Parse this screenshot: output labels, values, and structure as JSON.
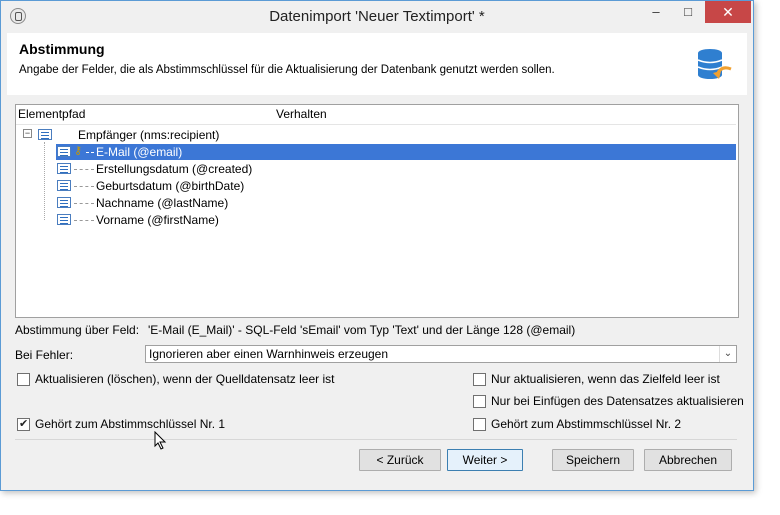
{
  "window": {
    "title": "Datenimport 'Neuer Textimport' *",
    "minimize": "–",
    "maximize": "□",
    "close": "✕"
  },
  "header": {
    "title": "Abstimmung",
    "subtitle": "Angabe der Felder, die als Abstimmschlüssel für die Aktualisierung der Datenbank genutzt werden sollen.",
    "icon": "database-sync-icon"
  },
  "tree": {
    "columns": [
      "Elementpfad",
      "Verhalten"
    ],
    "root": "Empfänger (nms:recipient)",
    "children": [
      {
        "label": "E-Mail (@email)",
        "selected": true,
        "key": true
      },
      {
        "label": "Erstellungsdatum (@created)",
        "selected": false,
        "key": false
      },
      {
        "label": "Geburtsdatum (@birthDate)",
        "selected": false,
        "key": false
      },
      {
        "label": "Nachname (@lastName)",
        "selected": false,
        "key": false
      },
      {
        "label": "Vorname (@firstName)",
        "selected": false,
        "key": false
      }
    ]
  },
  "reconciliation": {
    "label": "Abstimmung über Feld:",
    "value": "'E-Mail (E_Mail)' - SQL-Feld 'sEmail' vom Typ 'Text' und der Länge 128 (@email)"
  },
  "error": {
    "label": "Bei Fehler:",
    "selected": "Ignorieren aber einen Warnhinweis erzeugen"
  },
  "checkboxes": {
    "update_delete": {
      "label": "Aktualisieren (löschen), wenn der Quelldatensatz leer ist",
      "checked": false
    },
    "update_if_empty": {
      "label": "Nur aktualisieren, wenn das Zielfeld leer ist",
      "checked": false
    },
    "update_on_insert": {
      "label": "Nur bei Einfügen des Datensatzes aktualisieren",
      "checked": false
    },
    "key1": {
      "label": "Gehört zum Abstimmschlüssel Nr. 1",
      "checked": true
    },
    "key2": {
      "label": "Gehört zum Abstimmschlüssel Nr. 2",
      "checked": false
    }
  },
  "buttons": {
    "back": "< Zurück",
    "next": "Weiter >",
    "save": "Speichern",
    "cancel": "Abbrechen"
  },
  "colors": {
    "selection": "#3c77d6",
    "close_button": "#c74747",
    "accent": "#5b9bd5"
  }
}
